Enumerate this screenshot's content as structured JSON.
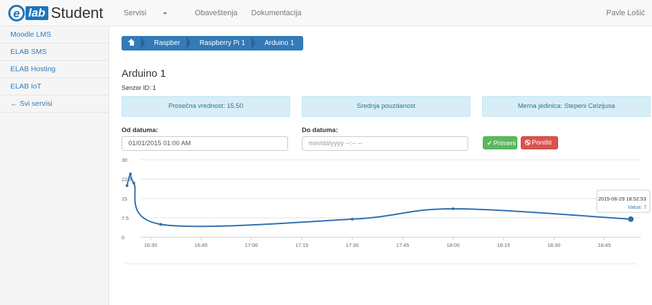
{
  "brand": {
    "e": "e",
    "lab": "lab",
    "text": "Student"
  },
  "nav": {
    "items": [
      "Servisi",
      "Obaveštenja",
      "Dokumentacija"
    ],
    "user": "Pavle Lošić"
  },
  "sidebar": {
    "items": [
      {
        "label": "Moodle LMS"
      },
      {
        "label": "ELAB SMS"
      },
      {
        "label": "ELAB Hosting"
      },
      {
        "label": "ELAB IoT"
      }
    ],
    "back_label": "Svi servisi"
  },
  "breadcrumb": {
    "items": [
      "Raspber",
      "Raspberry Pi 1",
      "Arduino 1"
    ]
  },
  "page": {
    "title": "Arduino 1",
    "sensor_id": "Senzor ID: 1",
    "info": {
      "average": "Prosečna vrednost: 15.50",
      "reliability": "Srednja pouzdanost",
      "unit": "Merna jedinica: Stepeni Celzijusa"
    }
  },
  "form": {
    "from_label": "Od datuma:",
    "from_value": "01/01/2015 01:00 AM",
    "to_label": "Do datuma:",
    "to_placeholder": "mm/dd/yyyy --:-- --",
    "apply_label": "Primeni",
    "reset_label": "Poništi"
  },
  "colors": {
    "primary": "#337ab7",
    "success": "#5cb85c",
    "danger": "#d9534f",
    "line": "#2f6fad"
  },
  "chart_data": {
    "type": "line",
    "x": [
      "16:23",
      "16:24",
      "16:25",
      "16:33",
      "17:30",
      "18:00",
      "18:52:53"
    ],
    "values": [
      20,
      24.5,
      21,
      5,
      7,
      11,
      7
    ],
    "y_ticks": [
      "0",
      "7.5",
      "15",
      "22.5",
      "30"
    ],
    "x_ticks": [
      "16:30",
      "16:45",
      "17:00",
      "17:15",
      "17:30",
      "17:45",
      "18:00",
      "18:15",
      "18:30",
      "18:45"
    ],
    "ylim": [
      0,
      30
    ],
    "tooltip": {
      "title": "2015-06-29 18:52:53",
      "value_label": "Value: 7"
    },
    "grid": true
  }
}
